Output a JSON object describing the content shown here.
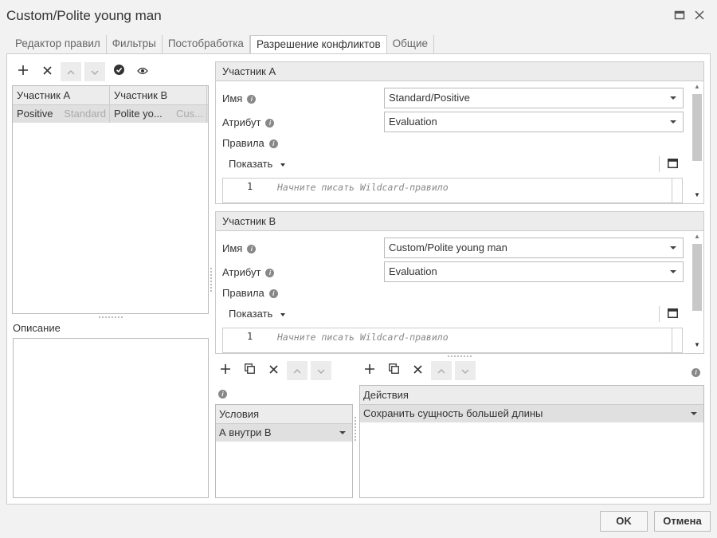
{
  "window": {
    "title": "Custom/Polite young man"
  },
  "tabs": [
    {
      "label": "Редактор правил"
    },
    {
      "label": "Фильтры"
    },
    {
      "label": "Постобработка"
    },
    {
      "label": "Разрешение конфликтов",
      "active": true
    },
    {
      "label": "Общие"
    }
  ],
  "left": {
    "grid": {
      "headers": [
        "Участник А",
        "Участник В"
      ],
      "rows": [
        {
          "a_main": "Positive",
          "a_sub": "Standard",
          "b_main": "Polite yo...",
          "b_sub": "Cus..."
        }
      ]
    },
    "description_label": "Описание"
  },
  "participant_a": {
    "header": "Участник А",
    "name_label": "Имя",
    "name_value": "Standard/Positive",
    "attr_label": "Атрибут",
    "attr_value": "Evaluation",
    "rules_label": "Правила",
    "show_label": "Показать",
    "line_number": "1",
    "placeholder": "Начните писать Wildcard-правило"
  },
  "participant_b": {
    "header": "Участник В",
    "name_label": "Имя",
    "name_value": "Custom/Polite young man",
    "attr_label": "Атрибут",
    "attr_value": "Evaluation",
    "rules_label": "Правила",
    "show_label": "Показать",
    "line_number": "1",
    "placeholder": "Начните писать Wildcard-правило"
  },
  "conditions": {
    "header": "Условия",
    "value": "А внутри В"
  },
  "actions": {
    "header": "Действия",
    "value": "Сохранить сущность большей длины"
  },
  "footer": {
    "ok": "OK",
    "cancel": "Отмена"
  },
  "icons": {
    "add": "+",
    "close": "✕",
    "up": "⌃",
    "down": "⌄",
    "check": "✔",
    "eye": "◉",
    "copy": "⧉",
    "maximize": "▭",
    "info": "i"
  }
}
